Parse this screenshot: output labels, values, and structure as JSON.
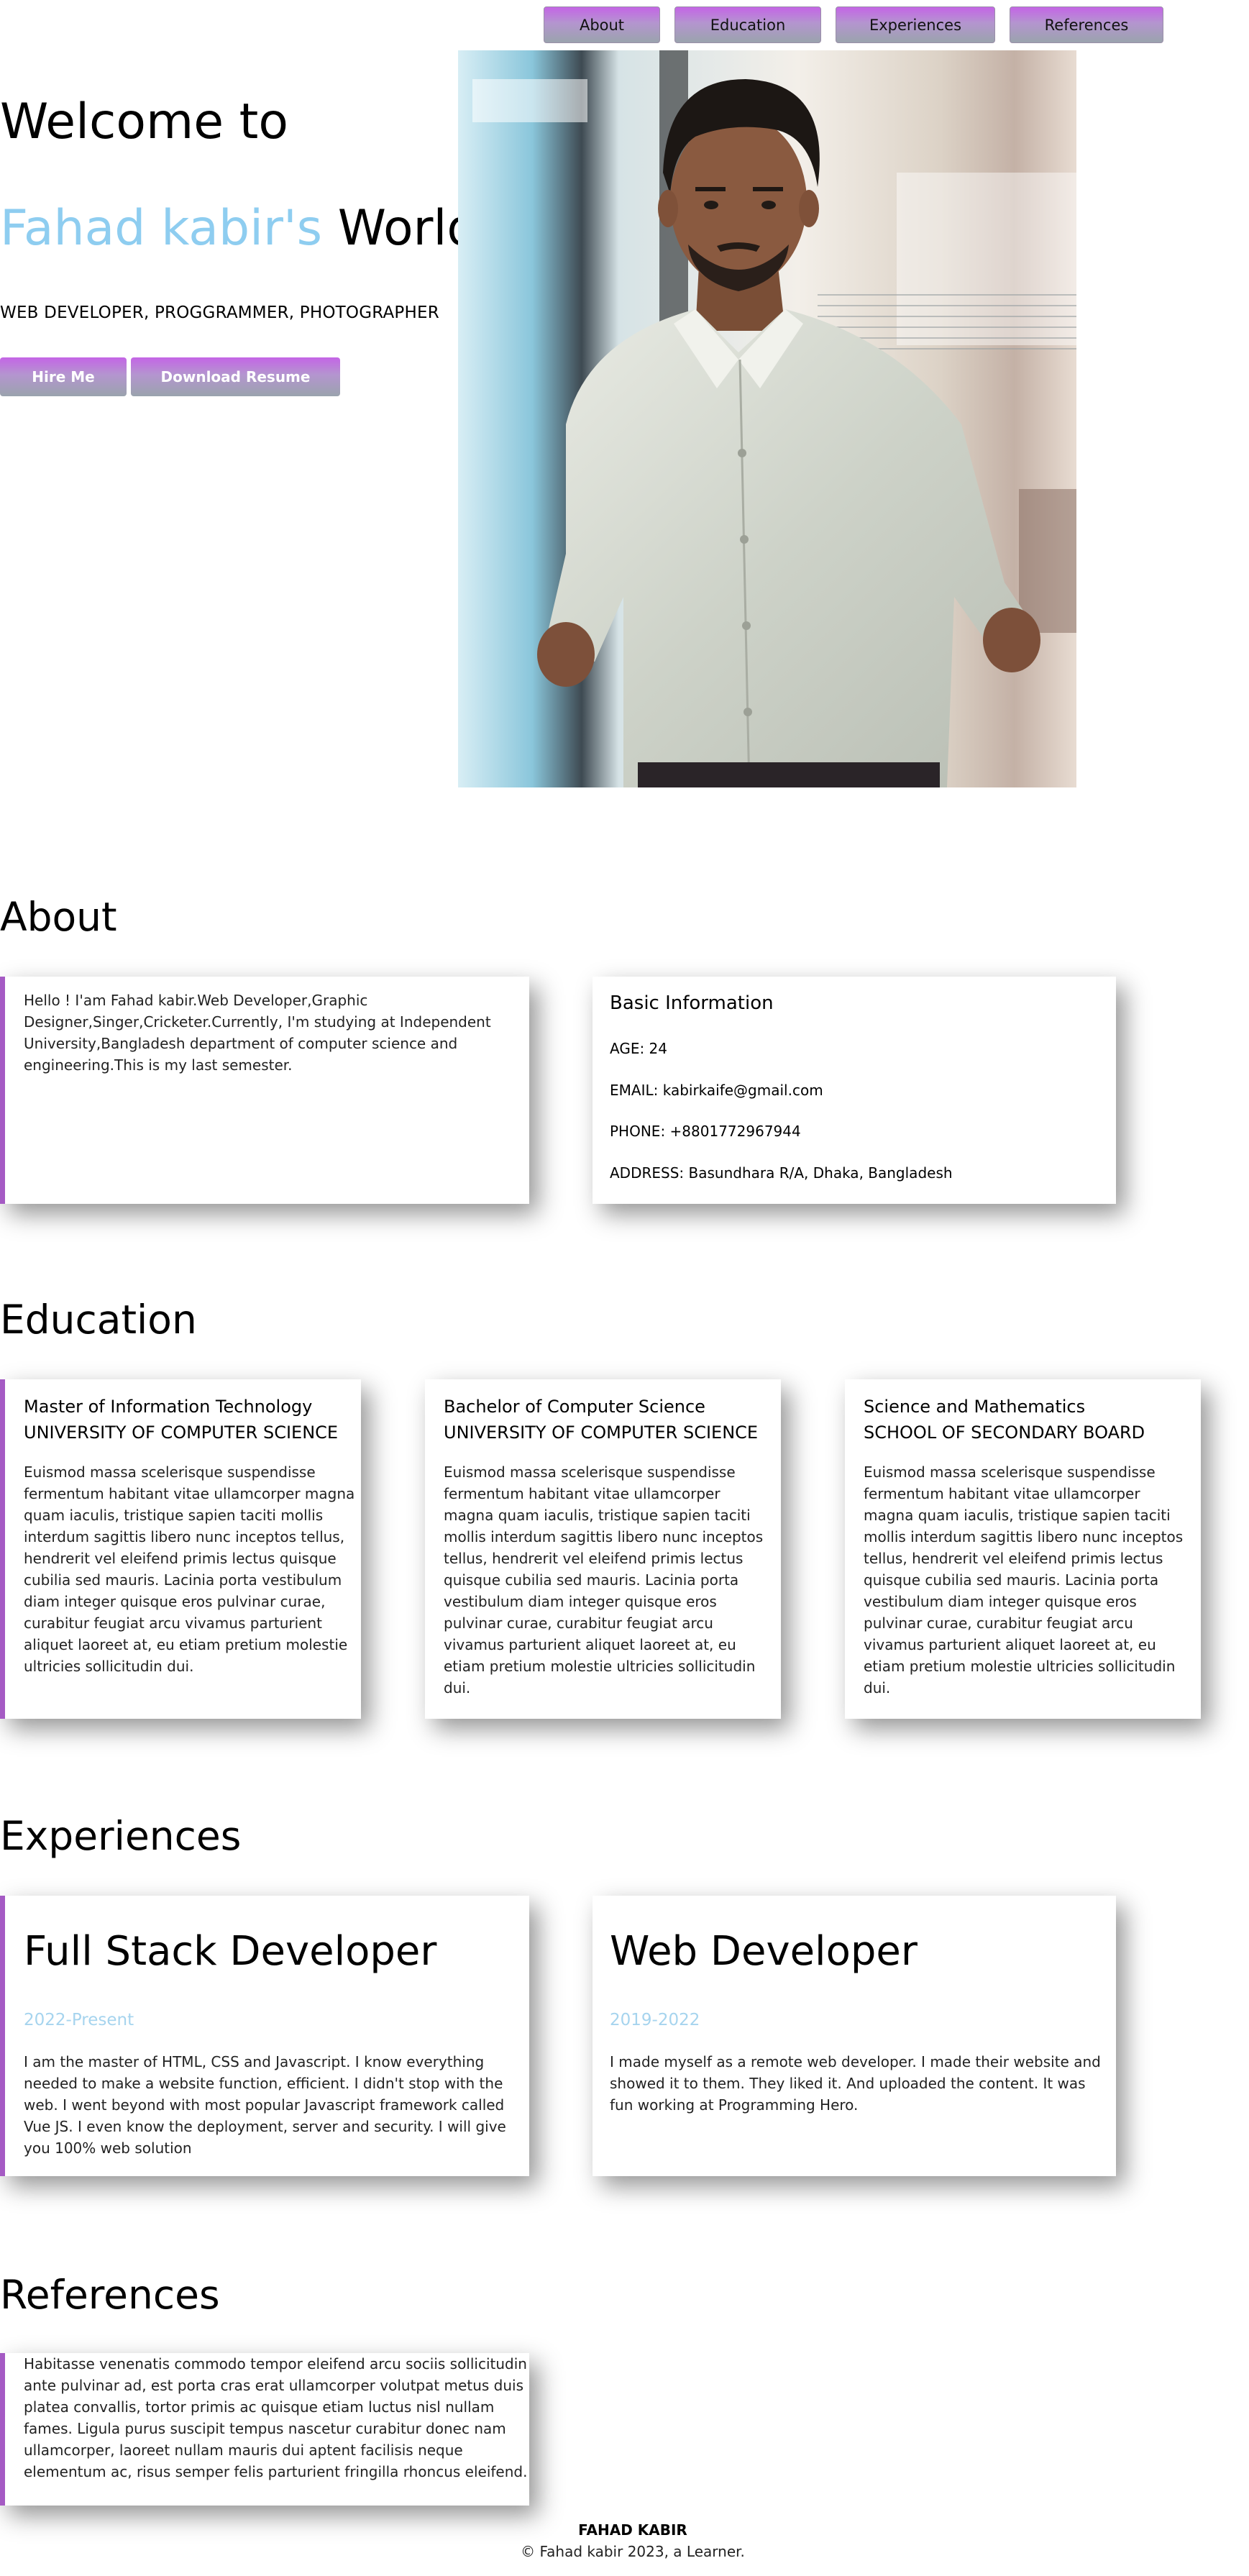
{
  "nav": {
    "items": [
      "About",
      "Education",
      "Experiences",
      "References"
    ]
  },
  "hero": {
    "welcome": "Welcome to",
    "name_highlight": "Fahad kabir's",
    "world": "World",
    "tagline": "WEB DEVELOPER, PROGGRAMMER, PHOTOGRAPHER",
    "hire_label": "Hire Me",
    "resume_label": "Download Resume"
  },
  "about": {
    "title": "About",
    "intro": "Hello ! I'am Fahad kabir.Web Developer,Graphic Designer,Singer,Cricketer.Currently, I'm studying at Independent University,Bangladesh department of computer science and engineering.This is my last semester.",
    "info_title": "Basic Information",
    "age": "AGE: 24",
    "email": "EMAIL: kabirkaife@gmail.com",
    "phone": "PHONE: +8801772967944",
    "address": "ADDRESS: Basundhara R/A, Dhaka, Bangladesh"
  },
  "education": {
    "title": "Education",
    "items": [
      {
        "degree": "Master of Information Technology",
        "school": "UNIVERSITY OF COMPUTER SCIENCE",
        "text": "Euismod massa scelerisque suspendisse fermentum habitant vitae ullamcorper magna quam iaculis, tristique sapien taciti mollis interdum sagittis libero nunc inceptos tellus, hendrerit vel eleifend primis lectus quisque cubilia sed mauris. Lacinia porta vestibulum diam integer quisque eros pulvinar curae, curabitur feugiat arcu vivamus parturient aliquet laoreet at, eu etiam pretium molestie ultricies sollicitudin dui."
      },
      {
        "degree": "Bachelor of Computer Science",
        "school": "UNIVERSITY OF COMPUTER SCIENCE",
        "text": "Euismod massa scelerisque suspendisse fermentum habitant vitae ullamcorper magna quam iaculis, tristique sapien taciti mollis interdum sagittis libero nunc inceptos tellus, hendrerit vel eleifend primis lectus quisque cubilia sed mauris. Lacinia porta vestibulum diam integer quisque eros pulvinar curae, curabitur feugiat arcu vivamus parturient aliquet laoreet at, eu etiam pretium molestie ultricies sollicitudin dui."
      },
      {
        "degree": "Science and Mathematics",
        "school": "SCHOOL OF SECONDARY BOARD",
        "text": "Euismod massa scelerisque suspendisse fermentum habitant vitae ullamcorper magna quam iaculis, tristique sapien taciti mollis interdum sagittis libero nunc inceptos tellus, hendrerit vel eleifend primis lectus quisque cubilia sed mauris. Lacinia porta vestibulum diam integer quisque eros pulvinar curae, curabitur feugiat arcu vivamus parturient aliquet laoreet at, eu etiam pretium molestie ultricies sollicitudin dui."
      }
    ]
  },
  "experiences": {
    "title": "Experiences",
    "items": [
      {
        "role": "Full Stack Developer",
        "period": "2022-Present",
        "text": "I am the master of HTML, CSS and Javascript. I know everything needed to make a website function, efficient. I didn't stop with the web. I went beyond with most popular Javascript framework called Vue JS. I even know the deployment, server and security. I will give you 100% web solution"
      },
      {
        "role": "Web Developer",
        "period": "2019-2022",
        "text": "I made myself as a remote web developer. I made their website and showed it to them. They liked it. And uploaded the content. It was fun working at Programming Hero."
      }
    ]
  },
  "references": {
    "title": "References",
    "text": "Habitasse venenatis commodo tempor eleifend arcu sociis sollicitudin ante pulvinar ad, est porta cras erat ullamcorper volutpat metus duis platea convallis, tortor primis ac quisque etiam luctus nisl nullam fames. Ligula purus suscipit tempus nascetur curabitur donec nam ullamcorper, laoreet nullam mauris dui aptent facilisis neque elementum ac, risus semper felis parturient fringilla rhoncus eleifend."
  },
  "footer": {
    "name": "FAHAD KABIR",
    "copyright": "© Fahad kabir 2023, a Learner."
  },
  "colors": {
    "accent_text": "#8ecdf0",
    "card_bar": "#a55bc4",
    "button_gradient_top": "#c465e6",
    "button_gradient_bottom": "#9aa3ad"
  }
}
